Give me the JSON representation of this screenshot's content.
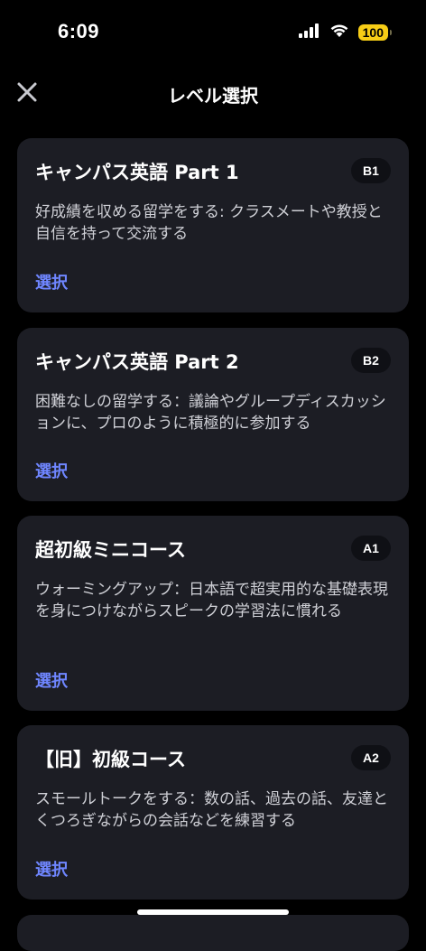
{
  "status_bar": {
    "time": "6:09",
    "battery": "100",
    "icons": [
      "cellular-signal-icon",
      "wifi-icon",
      "battery-icon"
    ]
  },
  "nav": {
    "title": "レベル選択",
    "close_icon": "close-icon"
  },
  "colors": {
    "background": "#000000",
    "card": "#1c1d24",
    "badge": "#0f1015",
    "link": "#6f86ff",
    "battery": "#f7cd16"
  },
  "courses": [
    {
      "title": "キャンパス英語 Part 1",
      "level": "B1",
      "description": "好成績を収める留学をする: クラスメートや教授と自信を持って交流する",
      "action": "選択"
    },
    {
      "title": "キャンパス英語 Part 2",
      "level": "B2",
      "description": "困難なしの留学する：議論やグループディスカッションに、プロのように積極的に参加する",
      "action": "選択"
    },
    {
      "title": "超初級ミニコース",
      "level": "A1",
      "description": "ウォーミングアップ：日本語で超実用的な基礎表現を身につけながらスピークの学習法に慣れる",
      "action": "選択"
    },
    {
      "title": "【旧】初級コース",
      "level": "A2",
      "description": "スモールトークをする：数の話、過去の話、友達とくつろぎながらの会話などを練習する",
      "action": "選択"
    }
  ]
}
